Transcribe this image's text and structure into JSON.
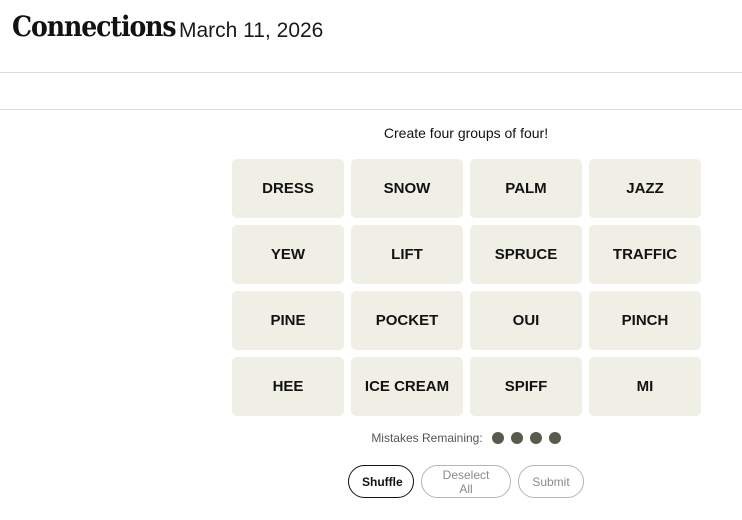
{
  "header": {
    "title": "Connections",
    "date": "March 11, 2026"
  },
  "game": {
    "instructions": "Create four groups of four!",
    "tiles": [
      "DRESS",
      "SNOW",
      "PALM",
      "JAZZ",
      "YEW",
      "LIFT",
      "SPRUCE",
      "TRAFFIC",
      "PINE",
      "POCKET",
      "OUI",
      "PINCH",
      "HEE",
      "ICE CREAM",
      "SPIFF",
      "MI"
    ],
    "mistakes_label": "Mistakes Remaining:",
    "mistakes_remaining": 4
  },
  "controls": {
    "shuffle_label": "Shuffle",
    "deselect_label": "Deselect All",
    "submit_label": "Submit"
  },
  "colors": {
    "tile_bg": "#efefe6",
    "dot": "#5a594e"
  }
}
